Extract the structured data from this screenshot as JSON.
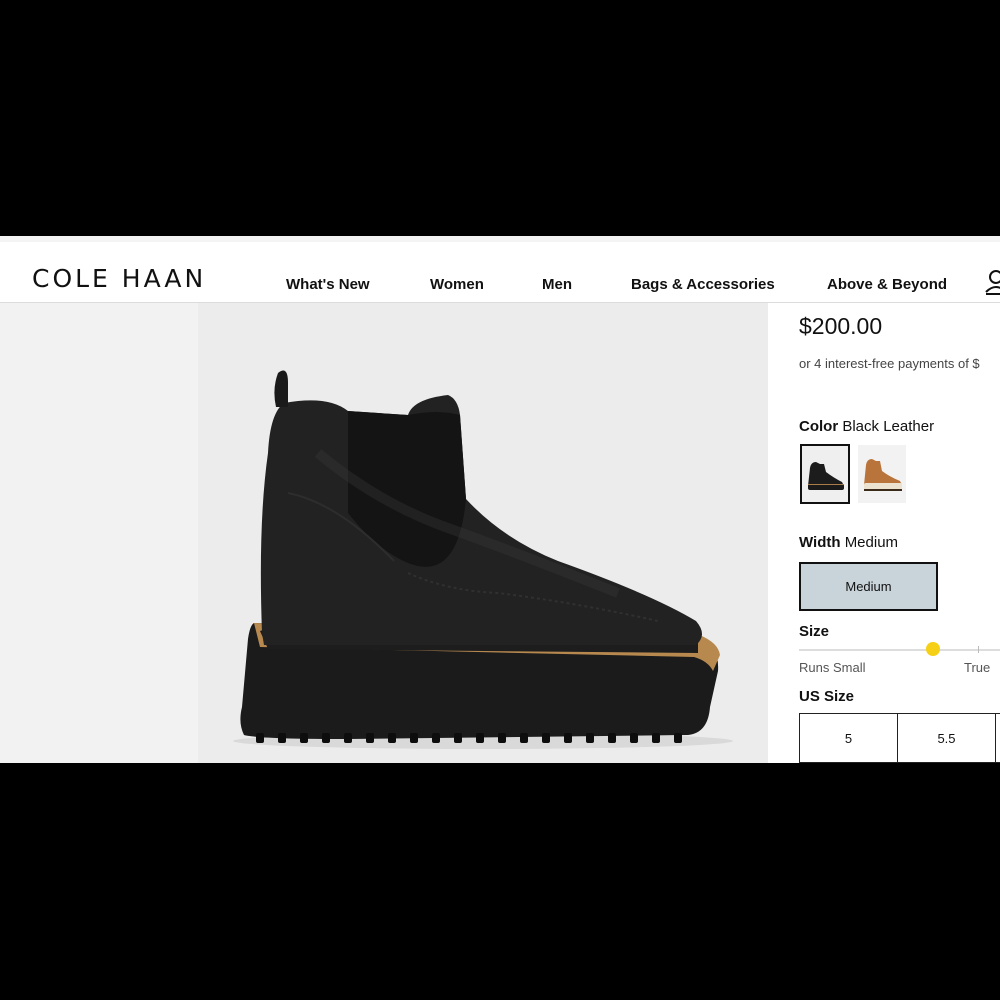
{
  "brand": {
    "logo_text": "COLE HAAN"
  },
  "nav": {
    "items": [
      {
        "label": "What's New"
      },
      {
        "label": "Women"
      },
      {
        "label": "Men"
      },
      {
        "label": "Bags & Accessories"
      },
      {
        "label": "Above & Beyond"
      }
    ],
    "account_icon": "user-icon"
  },
  "product": {
    "image_alt": "black leather wedge chelsea boot",
    "price": "$200.00",
    "installments_text": "or 4 interest-free payments of $",
    "color": {
      "label": "Color",
      "value": "Black Leather",
      "swatches": [
        "Black Leather",
        "Brown Leather"
      ],
      "selected_index": 0
    },
    "width": {
      "label": "Width",
      "value": "Medium",
      "options": [
        "Medium"
      ],
      "selected_index": 0
    },
    "fit": {
      "label": "Size",
      "left_label": "Runs Small",
      "right_label": "True"
    },
    "us_size": {
      "label": "US Size",
      "options": [
        "5",
        "5.5"
      ]
    }
  },
  "colors": {
    "selected_border": "#111111",
    "width_selected_bg": "#c9d4da",
    "fit_indicator": "#f5d016"
  }
}
